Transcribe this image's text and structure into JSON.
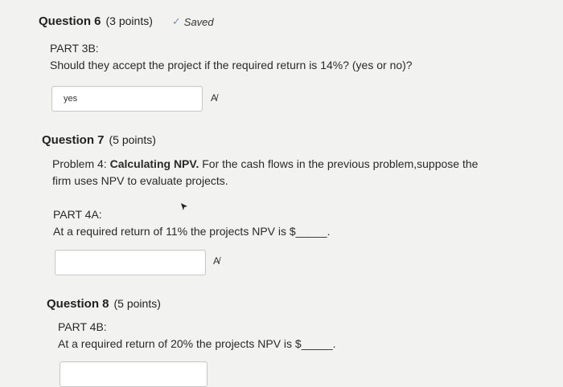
{
  "q6": {
    "title": "Question 6",
    "points": "(3 points)",
    "saved_label": "Saved",
    "check_icon": "checkmark-icon",
    "part_label": "PART 3B:",
    "prompt": "Should they accept the project if the required return is 14%? (yes or no)?",
    "answer_value": "yes",
    "spell_icon": "spellcheck-icon"
  },
  "q7": {
    "title": "Question 7",
    "points": "(5 points)",
    "problem_prefix": "Problem 4: ",
    "problem_title": "Calculating NPV.",
    "problem_text_1": " For the cash flows in the previous problem,suppose the",
    "problem_text_2": "firm uses NPV to evaluate projects.",
    "part_label": "PART 4A:",
    "prompt": "At a required return of 11% the projects NPV is $_____.",
    "answer_value": "",
    "spell_icon": "spellcheck-icon"
  },
  "q8": {
    "title": "Question 8",
    "points": "(5 points)",
    "part_label": "PART 4B:",
    "prompt": "At a required return of 20% the projects NPV is $_____."
  }
}
